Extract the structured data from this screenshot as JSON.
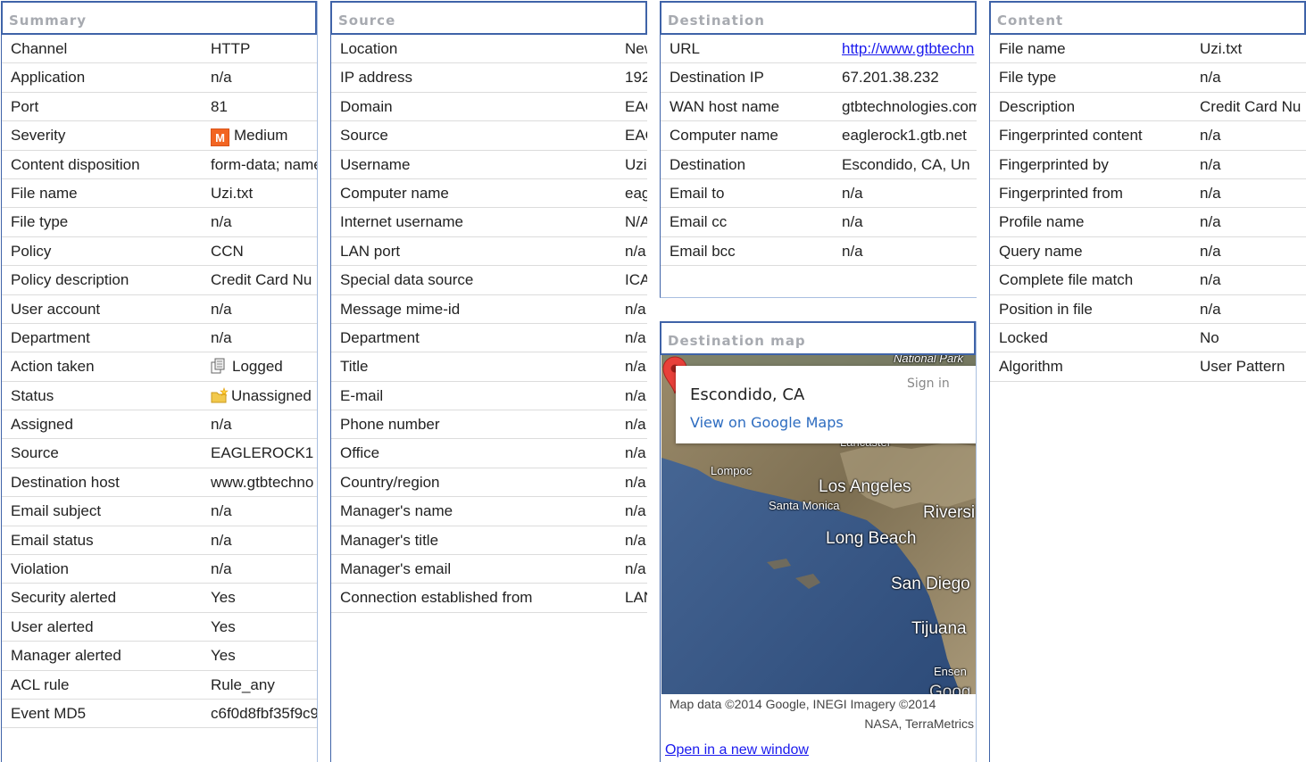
{
  "summary": {
    "title": "Summary",
    "rows": [
      {
        "label": "Channel",
        "value": "HTTP"
      },
      {
        "label": "Application",
        "value": "n/a"
      },
      {
        "label": "Port",
        "value": "81"
      },
      {
        "label": "Severity",
        "value": "Medium",
        "badge": "M"
      },
      {
        "label": "Content disposition",
        "value": "form-data; name"
      },
      {
        "label": "File name",
        "value": "Uzi.txt"
      },
      {
        "label": "File type",
        "value": "n/a"
      },
      {
        "label": "Policy",
        "value": "CCN"
      },
      {
        "label": "Policy description",
        "value": "Credit Card Nu"
      },
      {
        "label": "User account",
        "value": "n/a"
      },
      {
        "label": "Department",
        "value": "n/a"
      },
      {
        "label": "Action taken",
        "value": "Logged"
      },
      {
        "label": "Status",
        "value": "Unassigned"
      },
      {
        "label": "Assigned",
        "value": "n/a"
      },
      {
        "label": "Source",
        "value": "EAGLEROCK1"
      },
      {
        "label": "Destination host",
        "value": "www.gtbtechno"
      },
      {
        "label": "Email subject",
        "value": "n/a"
      },
      {
        "label": "Email status",
        "value": "n/a"
      },
      {
        "label": "Violation",
        "value": "n/a"
      },
      {
        "label": "Security alerted",
        "value": "Yes"
      },
      {
        "label": "User alerted",
        "value": "Yes"
      },
      {
        "label": "Manager alerted",
        "value": "Yes"
      },
      {
        "label": "ACL rule",
        "value": "Rule_any"
      },
      {
        "label": "Event MD5",
        "value": "c6f0d8fbf35f9c9"
      }
    ]
  },
  "source": {
    "title": "Source",
    "rows": [
      {
        "label": "Location",
        "value": "New"
      },
      {
        "label": "IP address",
        "value": "192"
      },
      {
        "label": "Domain",
        "value": "EAG"
      },
      {
        "label": "Source",
        "value": "EAG"
      },
      {
        "label": "Username",
        "value": "Uzi"
      },
      {
        "label": "Computer name",
        "value": "eag"
      },
      {
        "label": "Internet username",
        "value": "N/A"
      },
      {
        "label": "LAN port",
        "value": "n/a"
      },
      {
        "label": "Special data source",
        "value": "ICA"
      },
      {
        "label": "Message mime-id",
        "value": "n/a"
      },
      {
        "label": "Department",
        "value": "n/a"
      },
      {
        "label": "Title",
        "value": "n/a"
      },
      {
        "label": "E-mail",
        "value": "n/a"
      },
      {
        "label": "Phone number",
        "value": "n/a"
      },
      {
        "label": "Office",
        "value": "n/a"
      },
      {
        "label": "Country/region",
        "value": "n/a"
      },
      {
        "label": "Manager's name",
        "value": "n/a"
      },
      {
        "label": "Manager's title",
        "value": "n/a"
      },
      {
        "label": "Manager's email",
        "value": "n/a"
      },
      {
        "label": "Connection established from",
        "value": "LAN"
      }
    ]
  },
  "destination": {
    "title": "Destination",
    "rows": [
      {
        "label": "URL",
        "value": "http://www.gtbtechn"
      },
      {
        "label": "Destination IP",
        "value": "67.201.38.232"
      },
      {
        "label": "WAN host name",
        "value": "gtbtechnologies.com"
      },
      {
        "label": "Computer name",
        "value": "eaglerock1.gtb.net"
      },
      {
        "label": "Destination",
        "value": "Escondido, CA, Un"
      },
      {
        "label": "Email to",
        "value": "n/a"
      },
      {
        "label": "Email cc",
        "value": "n/a"
      },
      {
        "label": "Email bcc",
        "value": "n/a"
      }
    ]
  },
  "map": {
    "title": "Destination map",
    "place": "Escondido, CA",
    "view_link": "View on Google Maps",
    "sign_in": "Sign in",
    "labels": {
      "national_park": "National Park",
      "lancaster": "Lancaster",
      "lompoc": "Lompoc",
      "los_angeles": "Los Angeles",
      "santa_monica": "Santa Monica",
      "riverside": "Riversi",
      "long_beach": "Long Beach",
      "san_diego": "San Diego",
      "tijuana": "Tijuana",
      "ensenada": "Ensen",
      "google": "Goog"
    },
    "attribution_line1": "Map data ©2014 Google, INEGI Imagery ©2014",
    "attribution_line2": "NASA, TerraMetrics",
    "open_link": "Open in a new window",
    "colors": {
      "ocean": "#3a5a8a",
      "land": "#8a7a5a",
      "pin": "#e8403a"
    }
  },
  "content": {
    "title": "Content",
    "rows": [
      {
        "label": "File name",
        "value": "Uzi.txt"
      },
      {
        "label": "File type",
        "value": "n/a"
      },
      {
        "label": "Description",
        "value": "Credit Card Nu"
      },
      {
        "label": "Fingerprinted content",
        "value": "n/a"
      },
      {
        "label": "Fingerprinted by",
        "value": "n/a"
      },
      {
        "label": "Fingerprinted from",
        "value": "n/a"
      },
      {
        "label": "Profile name",
        "value": "n/a"
      },
      {
        "label": "Query name",
        "value": "n/a"
      },
      {
        "label": "Complete file match",
        "value": "n/a"
      },
      {
        "label": "Position in file",
        "value": "n/a"
      },
      {
        "label": "Locked",
        "value": "No"
      },
      {
        "label": "Algorithm",
        "value": "User Pattern"
      }
    ]
  },
  "theme": {
    "panel_border": "#3f63a8",
    "title_text": "#a7aab0",
    "severity_badge": "#f26522",
    "link": "#1a1aee"
  }
}
